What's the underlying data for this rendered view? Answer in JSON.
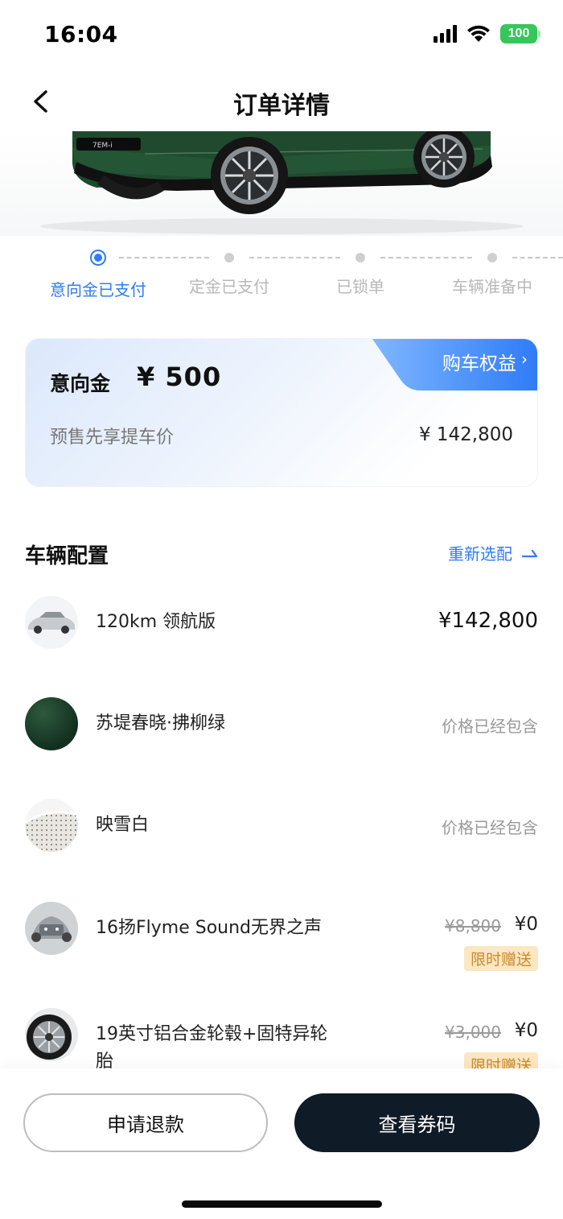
{
  "status_bar": {
    "time": "16:04",
    "battery": "100"
  },
  "nav": {
    "title": "订单详情"
  },
  "steps": [
    {
      "label": "意向金已支付",
      "active": true
    },
    {
      "label": "定金已支付",
      "active": false
    },
    {
      "label": "已锁单",
      "active": false
    },
    {
      "label": "车辆准备中",
      "active": false
    }
  ],
  "deposit_card": {
    "label": "意向金",
    "amount": "¥ 500",
    "benefit_tab": "购车权益",
    "presale_label": "预售先享提车价",
    "presale_price": "¥ 142,800"
  },
  "config": {
    "title": "车辆配置",
    "reconfigure_label": "重新选配",
    "items": [
      {
        "name": "120km 领航版",
        "price": "¥142,800"
      },
      {
        "name": "苏堤春晓·拂柳绿",
        "note": "价格已经包含"
      },
      {
        "name": "映雪白",
        "note": "价格已经包含"
      },
      {
        "name": "16扬Flyme Sound无界之声",
        "old_price": "¥8,800",
        "new_price": "¥0",
        "badge": "限时赠送"
      },
      {
        "name": "19英寸铝合金轮毂+固特异轮胎",
        "old_price": "¥3,000",
        "new_price": "¥0",
        "badge": "限时赠送"
      }
    ]
  },
  "bottom": {
    "refund_label": "申请退款",
    "voucher_label": "查看券码"
  },
  "colors": {
    "accent": "#2f7cf6",
    "car_green": "#1e4a2c",
    "dark_button": "#0f1b26",
    "gift_bg": "#fbe7c2"
  }
}
